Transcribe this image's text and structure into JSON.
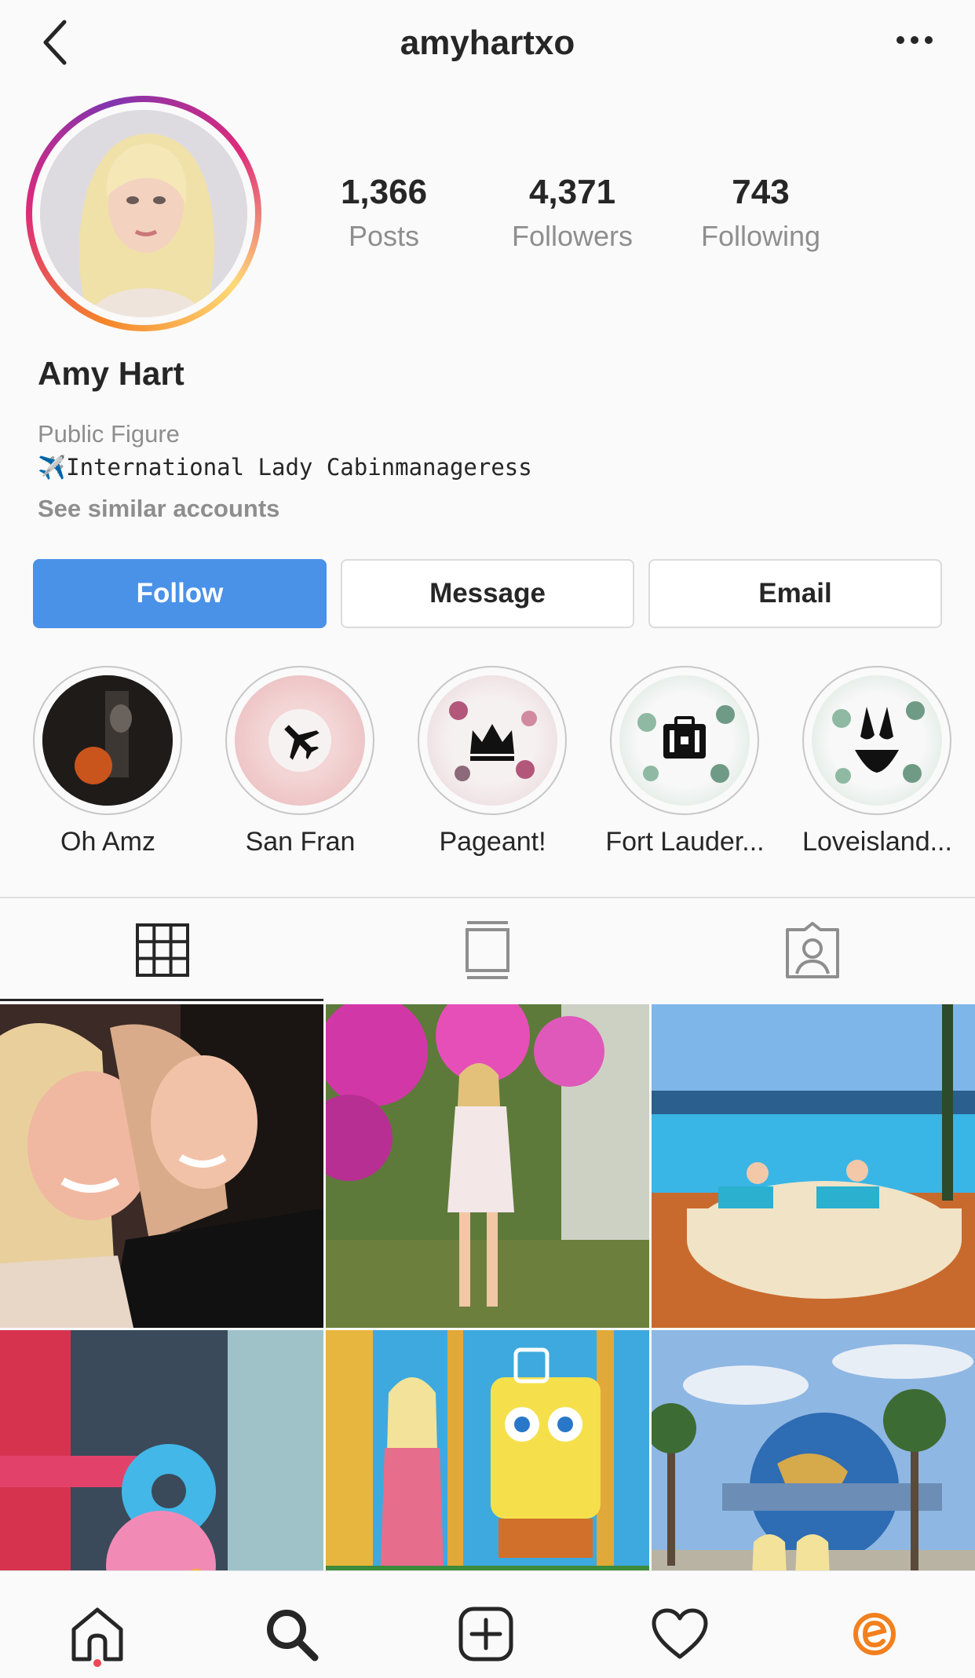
{
  "header": {
    "username": "amyhartxo"
  },
  "profile": {
    "stats": [
      {
        "value": "1,366",
        "label": "Posts"
      },
      {
        "value": "4,371",
        "label": "Followers"
      },
      {
        "value": "743",
        "label": "Following"
      }
    ],
    "name": "Amy Hart",
    "category": "Public Figure",
    "bio": "✈️International Lady Cabinmanageress",
    "similar_link": "See similar accounts"
  },
  "actions": {
    "follow": "Follow",
    "message": "Message",
    "email": "Email"
  },
  "highlights": [
    {
      "label": "Oh Amz",
      "icon": "photo"
    },
    {
      "label": "San Fran",
      "icon": "airplane-icon"
    },
    {
      "label": "Pageant!",
      "icon": "crown-icon"
    },
    {
      "label": "Fort Lauder...",
      "icon": "suitcase-icon"
    },
    {
      "label": "Loveisland...",
      "icon": "bikini-icon"
    }
  ],
  "tabs": [
    {
      "icon": "grid-icon"
    },
    {
      "icon": "feed-icon"
    },
    {
      "icon": "tagged-icon"
    }
  ],
  "bottom_nav": [
    {
      "icon": "home-icon"
    },
    {
      "icon": "search-icon"
    },
    {
      "icon": "add-icon"
    },
    {
      "icon": "heart-icon"
    },
    {
      "icon": "profile-icon"
    }
  ],
  "colors": {
    "follow_button": "#4a91e8",
    "notification_dot": "#ed4956",
    "secondary_text": "#8e8e8e"
  }
}
